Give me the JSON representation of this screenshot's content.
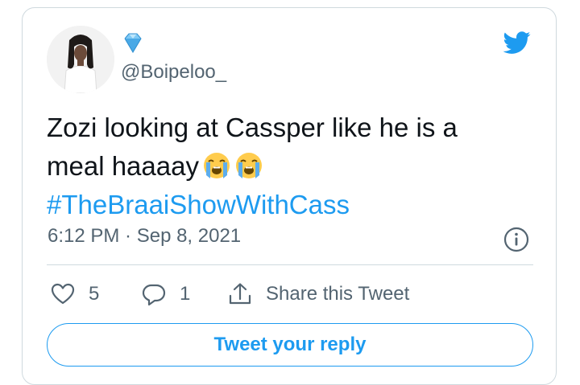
{
  "tweet": {
    "handle": "@Boipeloo_",
    "text_line1": "Zozi looking at Cassper like he is a",
    "text_line2": "meal haaaay",
    "hashtag": "#TheBraaiShowWithCass",
    "timestamp": "6:12 PM · Sep 8, 2021",
    "emojis": [
      "loudly-crying-face",
      "loudly-crying-face"
    ]
  },
  "actions": {
    "likes": "5",
    "replies": "1",
    "share_label": "Share this Tweet"
  },
  "reply_button_label": "Tweet your reply",
  "colors": {
    "brand_blue": "#1d9bf0",
    "secondary_text": "#536471",
    "border": "#cfd9de",
    "badge_diamond": "#7ec9f5"
  },
  "icons": [
    "diamond-icon",
    "twitter-bird-icon",
    "info-icon",
    "heart-icon",
    "reply-bubble-icon",
    "share-icon"
  ]
}
